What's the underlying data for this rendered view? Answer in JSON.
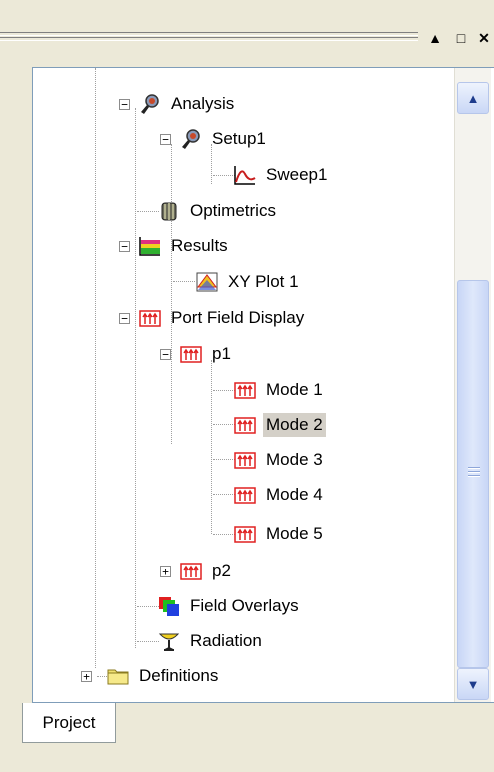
{
  "window": {
    "buttons": [
      "▲",
      "□",
      "✕"
    ]
  },
  "tree": {
    "items": [
      {
        "label": "Analysis",
        "icon": "analysis-icon",
        "expanded": true
      },
      {
        "label": "Setup1",
        "icon": "setup-icon",
        "expanded": true
      },
      {
        "label": "Sweep1",
        "icon": "sweep-icon"
      },
      {
        "label": "Optimetrics",
        "icon": "optimetrics-icon"
      },
      {
        "label": "Results",
        "icon": "results-icon",
        "expanded": true
      },
      {
        "label": "XY Plot 1",
        "icon": "xy-plot-icon"
      },
      {
        "label": "Port Field Display",
        "icon": "port-field-icon",
        "expanded": true
      },
      {
        "label": "p1",
        "icon": "port-field-icon",
        "expanded": true
      },
      {
        "label": "Mode 1",
        "icon": "port-field-icon"
      },
      {
        "label": "Mode 2",
        "icon": "port-field-icon",
        "selected": true
      },
      {
        "label": "Mode 3",
        "icon": "port-field-icon"
      },
      {
        "label": "Mode 4",
        "icon": "port-field-icon"
      },
      {
        "label": "Mode 5",
        "icon": "port-field-icon"
      },
      {
        "label": "p2",
        "icon": "port-field-icon",
        "expanded": false
      },
      {
        "label": "Field Overlays",
        "icon": "field-overlays-icon"
      },
      {
        "label": "Radiation",
        "icon": "radiation-icon"
      },
      {
        "label": "Definitions",
        "icon": "folder-icon",
        "expanded": false
      }
    ]
  },
  "tabs": {
    "project": "Project"
  },
  "colors": {
    "port_red": "#e02020",
    "selection": "#d4d0c8"
  }
}
